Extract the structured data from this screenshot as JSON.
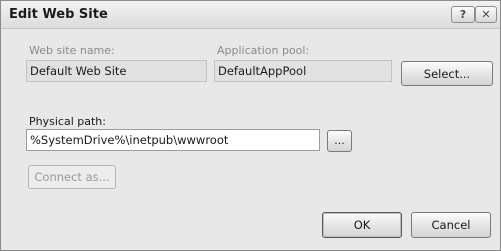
{
  "window": {
    "title": "Edit Web Site",
    "help_glyph": "?",
    "close_glyph": "✕"
  },
  "site": {
    "name_label": "Web site name:",
    "name_value": "Default Web Site"
  },
  "app_pool": {
    "label": "Application pool:",
    "value": "DefaultAppPool",
    "select_label": "Select..."
  },
  "physical_path": {
    "label": "Physical path:",
    "value": "%SystemDrive%\\inetpub\\wwwroot",
    "browse_label": "..."
  },
  "connect_as": {
    "label": "Connect as...",
    "enabled": false
  },
  "footer": {
    "ok_label": "OK",
    "cancel_label": "Cancel"
  }
}
